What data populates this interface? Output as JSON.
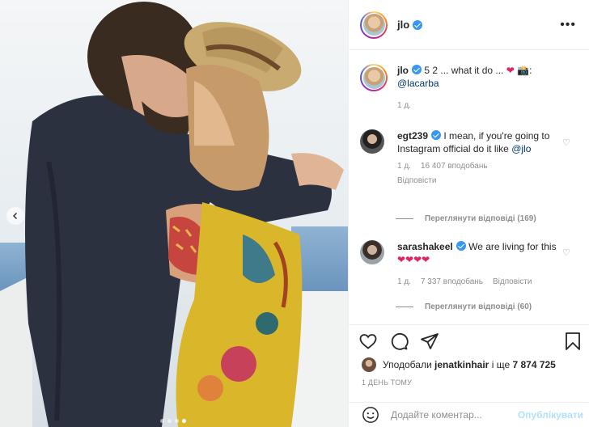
{
  "post": {
    "username": "jlo",
    "caption_text": "5 2 ... what it do ...",
    "caption_camera": "📸:",
    "caption_mention": "@lacarba",
    "caption_time": "1 д."
  },
  "comments": [
    {
      "username": "egt239",
      "text": "I mean, if you're going to Instagram official do it like",
      "mention": "@jlo",
      "time": "1 д.",
      "likes": "16 407 вподобань",
      "reply": "Відповісти",
      "view_replies": "Переглянути відповіді (169)"
    },
    {
      "username": "sarashakeel",
      "text": "We are living for this",
      "hearts": "❤❤❤❤",
      "time": "1 д.",
      "likes": "7 337 вподобань",
      "reply": "Відповісти",
      "view_replies": "Переглянути відповіді (60)"
    }
  ],
  "likes": {
    "prefix": "Уподобали",
    "user": "jenatkinhair",
    "and": "і ще",
    "count": "7 874 725"
  },
  "timestamp": "1 ДЕНЬ ТОМУ",
  "add_comment": {
    "placeholder": "Додайте коментар...",
    "post_label": "Опублікувати"
  },
  "icons": {
    "more": "more-options-icon",
    "like": "heart-icon",
    "comment": "comment-icon",
    "share": "share-icon",
    "save": "bookmark-icon",
    "emoji": "emoji-icon"
  },
  "carousel": {
    "total": 4,
    "active": 4
  },
  "colors": {
    "verified": "#3897f0",
    "heart": "#e0245e",
    "link": "#00376b",
    "post_disabled": "#b2dffc"
  }
}
